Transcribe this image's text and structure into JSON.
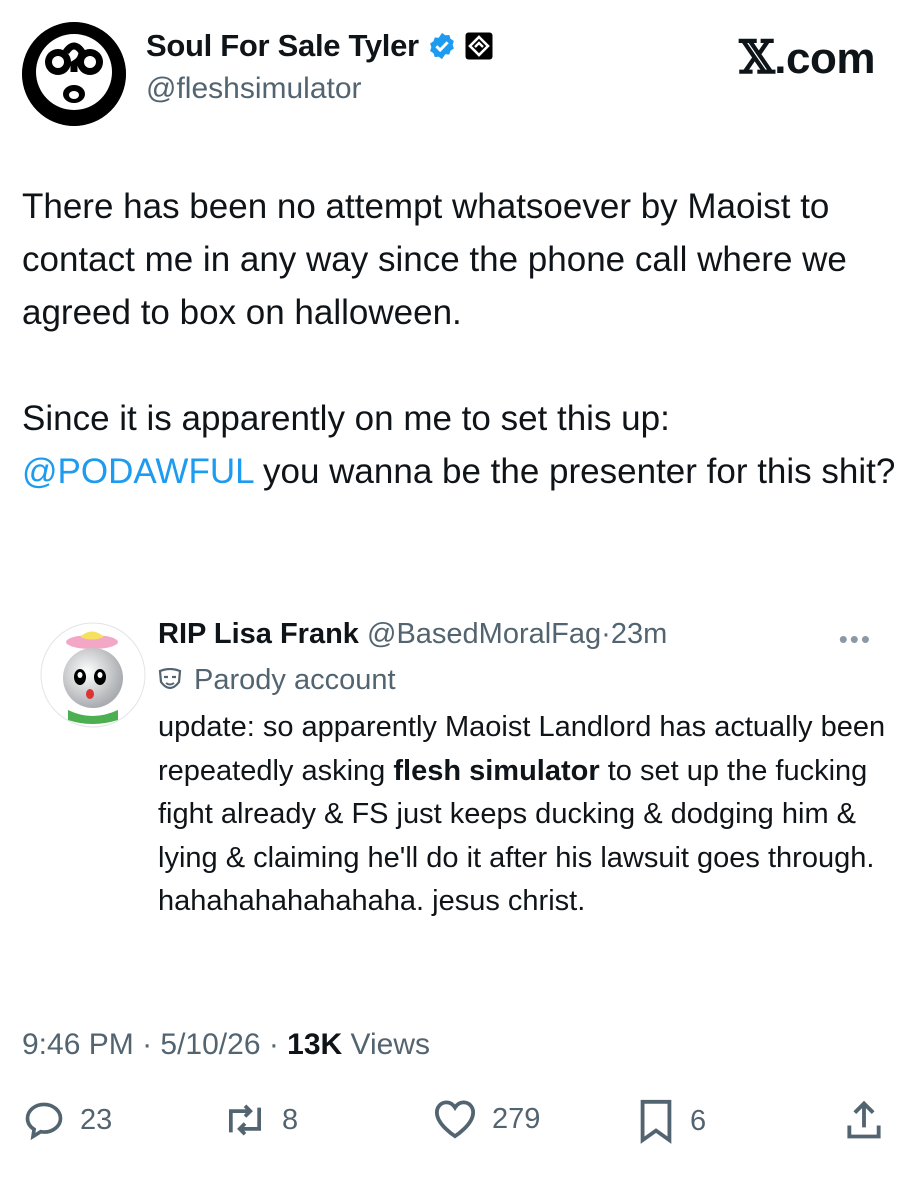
{
  "header": {
    "display_name": "Soul For Sale Tyler",
    "handle": "@fleshsimulator",
    "site_label": ".com",
    "verified_icon": "verified-badge-icon",
    "affiliate_icon": "affiliate-badge-icon"
  },
  "tweet": {
    "text_p1": "There has been no attempt whatsoever by Maoist to contact me in any way since the phone call where we agreed to box on halloween.",
    "text_p2": "Since it is apparently on me to set this up:",
    "mention": "@PODAWFUL",
    "text_p3": " you wanna be the presenter for this shit?"
  },
  "quote": {
    "name": "RIP Lisa Frank",
    "handle": "@BasedMoralFag",
    "sep": "·",
    "time": "23m",
    "parody_label": "Parody account",
    "body_pre": "update: so apparently Maoist Landlord has actually been repeatedly asking ",
    "body_bold": "flesh simulator",
    "body_post": " to set up the fucking fight already & FS just keeps ducking & dodging him & lying & claiming he'll do it after his lawsuit goes through. hahahahahahahaha. jesus christ."
  },
  "meta": {
    "time": "9:46 PM",
    "sep1": " · ",
    "date": "5/10/26",
    "sep2": " · ",
    "views_count": "13K",
    "views_label": " Views"
  },
  "actions": {
    "replies": "23",
    "reposts": "8",
    "likes": "279",
    "bookmarks": "6"
  },
  "colors": {
    "accent": "#1d9bf0",
    "muted": "#536471",
    "text": "#0f1419"
  }
}
